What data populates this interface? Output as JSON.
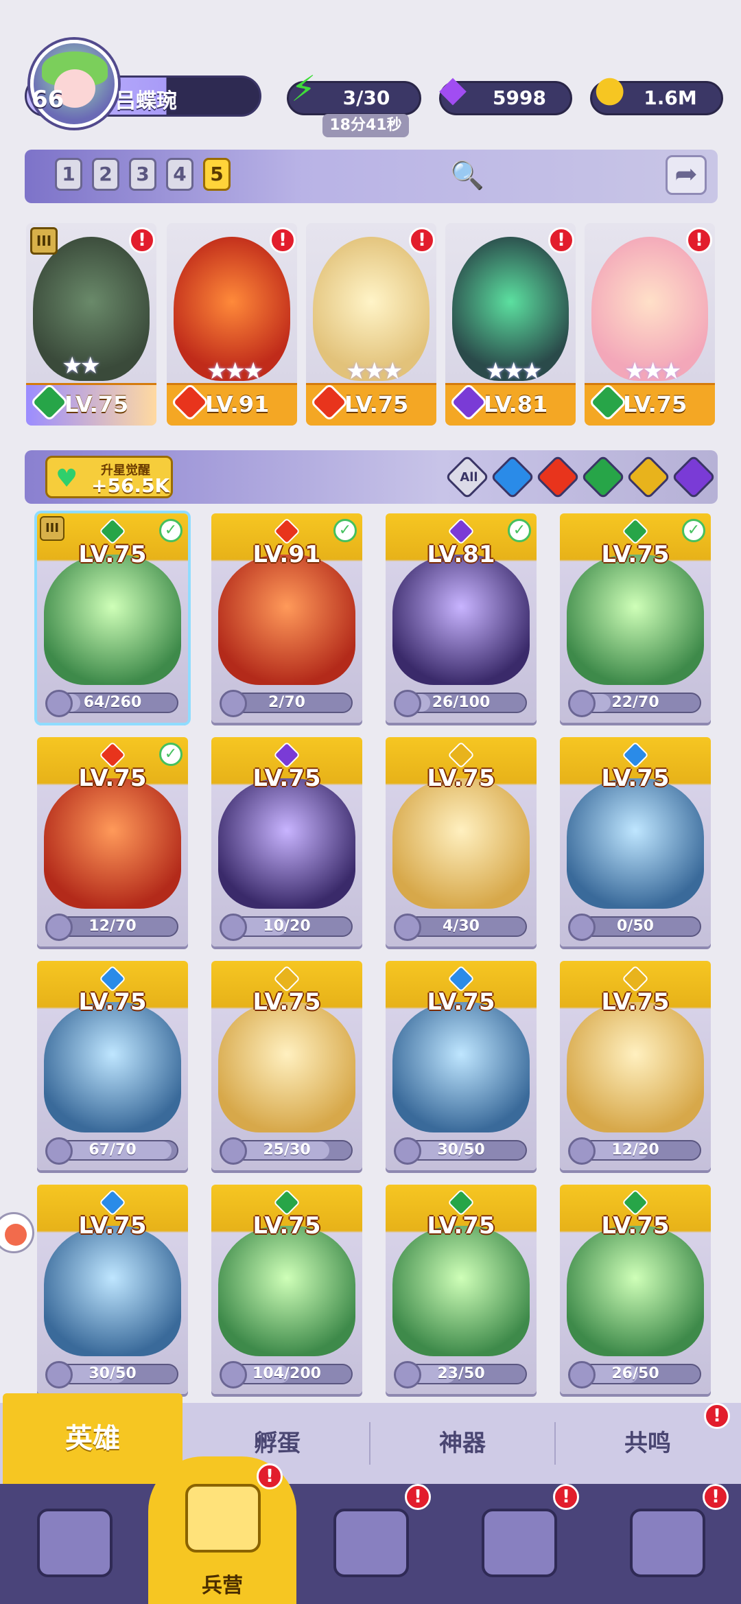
{
  "player": {
    "level": "66",
    "name": "吕蝶琬"
  },
  "resources": {
    "energy": "3/30",
    "energy_timer": "18分41秒",
    "gems": "5998",
    "gold": "1.6M"
  },
  "team_tabs": [
    "1",
    "2",
    "3",
    "4",
    "5"
  ],
  "active_team": "5",
  "team_cards": [
    {
      "level": "LV.75",
      "element": "nature",
      "stars": 2,
      "rank": "III",
      "alert": true
    },
    {
      "level": "LV.91",
      "element": "fire",
      "stars": 3,
      "alert": true
    },
    {
      "level": "LV.75",
      "element": "fire",
      "stars": 3,
      "alert": true
    },
    {
      "level": "LV.81",
      "element": "dark",
      "stars": 3,
      "alert": true
    },
    {
      "level": "LV.75",
      "element": "nature",
      "stars": 3,
      "alert": true
    }
  ],
  "awaken": {
    "label": "升星觉醒",
    "value": "+56.5K"
  },
  "filters": {
    "all_label": "All",
    "elements": [
      "water",
      "fire",
      "nature",
      "light",
      "dark"
    ]
  },
  "heroes": [
    {
      "level": "LV.75",
      "element": "nature",
      "shards": "64/260",
      "fill": 0.25,
      "checked": true,
      "rank": "III"
    },
    {
      "level": "LV.91",
      "element": "fire",
      "shards": "2/70",
      "fill": 0.03,
      "checked": true
    },
    {
      "level": "LV.81",
      "element": "dark",
      "shards": "26/100",
      "fill": 0.26,
      "checked": true
    },
    {
      "level": "LV.75",
      "element": "nature",
      "shards": "22/70",
      "fill": 0.31,
      "checked": true
    },
    {
      "level": "LV.75",
      "element": "fire",
      "shards": "12/70",
      "fill": 0.17,
      "checked": true
    },
    {
      "level": "LV.75",
      "element": "dark",
      "shards": "10/20",
      "fill": 0.5,
      "checked": false
    },
    {
      "level": "LV.75",
      "element": "light",
      "shards": "4/30",
      "fill": 0.13,
      "checked": false
    },
    {
      "level": "LV.75",
      "element": "water",
      "shards": "0/50",
      "fill": 0,
      "checked": false
    },
    {
      "level": "LV.75",
      "element": "water",
      "shards": "67/70",
      "fill": 0.96,
      "checked": false
    },
    {
      "level": "LV.75",
      "element": "light",
      "shards": "25/30",
      "fill": 0.83,
      "checked": false
    },
    {
      "level": "LV.75",
      "element": "water",
      "shards": "30/50",
      "fill": 0.6,
      "checked": false
    },
    {
      "level": "LV.75",
      "element": "light",
      "shards": "12/20",
      "fill": 0.6,
      "checked": false
    },
    {
      "level": "LV.75",
      "element": "water",
      "shards": "30/50",
      "fill": 0.6,
      "checked": false
    },
    {
      "level": "LV.75",
      "element": "nature",
      "shards": "104/200",
      "fill": 0.52,
      "checked": false
    },
    {
      "level": "LV.75",
      "element": "nature",
      "shards": "23/50",
      "fill": 0.46,
      "checked": false
    },
    {
      "level": "LV.75",
      "element": "nature",
      "shards": "26/50",
      "fill": 0.52,
      "checked": false
    }
  ],
  "subtabs": [
    "英雄",
    "孵蛋",
    "神器",
    "共鸣"
  ],
  "active_subtab": "英雄",
  "nav": {
    "barracks_label": "兵营"
  },
  "colors": {
    "fire": "#e8341c",
    "water": "#2a8be8",
    "nature": "#27a548",
    "light": "#e8b31c",
    "dark": "#7a3bd6",
    "accent": "#f6c622",
    "alert": "#e21d2c"
  }
}
